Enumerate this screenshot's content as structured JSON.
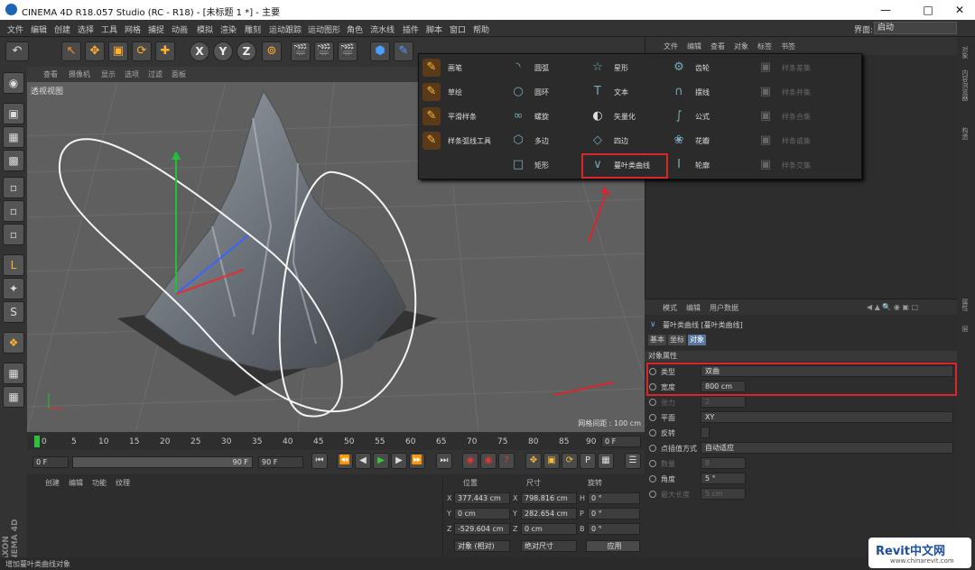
{
  "window": {
    "title": "CINEMA 4D R18.057 Studio (RC - R18) - [未标题 1 *] - 主要"
  },
  "menu": [
    "文件",
    "编辑",
    "创建",
    "选择",
    "工具",
    "网格",
    "捕捉",
    "动画",
    "模拟",
    "渲染",
    "雕刻",
    "运动跟踪",
    "运动图形",
    "角色",
    "流水线",
    "插件",
    "脚本",
    "窗口",
    "帮助"
  ],
  "layout": {
    "label": "界面:",
    "value": "启动"
  },
  "viewport_menu": [
    "查看",
    "摄像机",
    "显示",
    "选项",
    "过滤",
    "面板"
  ],
  "viewport": {
    "label": "透视视图",
    "grid": "网格间距 : 100 cm"
  },
  "timeline": {
    "ticks": [
      "0",
      "5",
      "10",
      "15",
      "20",
      "25",
      "30",
      "35",
      "40",
      "45",
      "50",
      "55",
      "60",
      "65",
      "70",
      "75",
      "80",
      "85",
      "90"
    ],
    "end": "0 F"
  },
  "transport": {
    "start": "0 F",
    "slider_end": "90 F",
    "end": "90 F"
  },
  "material_menu": [
    "创建",
    "编辑",
    "功能",
    "纹理"
  ],
  "coord": {
    "headers": [
      "位置",
      "尺寸",
      "旋转"
    ],
    "rows": [
      {
        "a": "X",
        "pos": "377.443 cm",
        "b": "X",
        "size": "798.816 cm",
        "c": "H",
        "rot": "0 °"
      },
      {
        "a": "Y",
        "pos": "0 cm",
        "b": "Y",
        "size": "282.654 cm",
        "c": "P",
        "rot": "0 °"
      },
      {
        "a": "Z",
        "pos": "-529.604 cm",
        "b": "Z",
        "size": "0 cm",
        "c": "B",
        "rot": "0 °"
      }
    ],
    "mode": "对象 (相对)",
    "sizemode": "绝对尺寸",
    "apply": "应用"
  },
  "status": "增加蔓叶类曲线对象",
  "object_menu": [
    "文件",
    "编辑",
    "查看",
    "对象",
    "标签",
    "书签"
  ],
  "attr_menu": [
    "模式",
    "编辑",
    "用户数据"
  ],
  "attr": {
    "title": "蔓叶类曲线 [蔓叶类曲线]",
    "tabs": [
      "基本",
      "坐标",
      "对象"
    ],
    "section": "对象属性",
    "rows": [
      {
        "label": "类型",
        "value": "双曲"
      },
      {
        "label": "宽度",
        "value": "800 cm"
      },
      {
        "label": "张力",
        "value": "2"
      },
      {
        "label": "平面",
        "value": "XY"
      },
      {
        "label": "反转",
        "value": ""
      },
      {
        "label": "点插值方式",
        "value": "自动适应"
      },
      {
        "label": "数量",
        "value": "8"
      },
      {
        "label": "角度",
        "value": "5 °"
      },
      {
        "label": "最大长度",
        "value": "5 cm"
      }
    ]
  },
  "side_tabs": [
    "对象",
    "内容浏览器",
    "构造",
    "属性",
    "层"
  ],
  "popup": {
    "col1": [
      "画笔",
      "草绘",
      "平滑样条",
      "样条弧线工具"
    ],
    "col2": [
      "圆弧",
      "圆环",
      "螺旋",
      "多边",
      "矩形"
    ],
    "col3": [
      "星形",
      "文本",
      "矢量化",
      "四边",
      "蔓叶类曲线"
    ],
    "col4": [
      "齿轮",
      "摆线",
      "公式",
      "花瓣",
      "轮廓"
    ],
    "col5": [
      "样条差集",
      "样条并集",
      "样条合集",
      "样条或集",
      "样条交集"
    ]
  },
  "watermark": {
    "brand": "Revit中文网",
    "url": "www.chinarevit.com"
  },
  "logo": "MAXON CINEMA 4D",
  "accent": "#d8262a"
}
